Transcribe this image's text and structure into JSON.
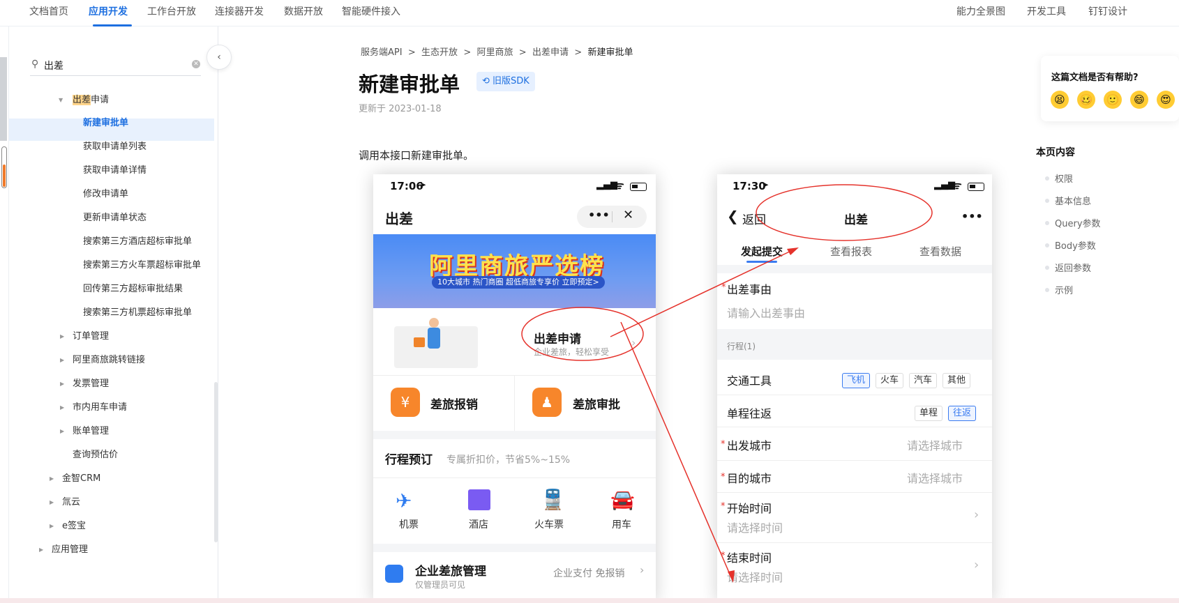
{
  "topnav": {
    "items": [
      "文档首页",
      "应用开发",
      "工作台开放",
      "连接器开发",
      "数据开放",
      "智能硬件接入"
    ],
    "right_items": [
      "能力全景图",
      "开发工具",
      "钉钉设计"
    ]
  },
  "sidebar": {
    "search_value": "出差",
    "tree": [
      {
        "label_hl": "出差",
        "label_rest": "申请"
      },
      {
        "label": "新建审批单"
      },
      {
        "label": "获取申请单列表"
      },
      {
        "label": "获取申请单详情"
      },
      {
        "label": "修改申请单"
      },
      {
        "label": "更新申请单状态"
      },
      {
        "label": "搜索第三方酒店超标审批单"
      },
      {
        "label": "搜索第三方火车票超标审批单"
      },
      {
        "label": "回传第三方超标审批结果"
      },
      {
        "label": "搜索第三方机票超标审批单"
      },
      {
        "label": "订单管理"
      },
      {
        "label": "阿里商旅跳转链接"
      },
      {
        "label": "发票管理"
      },
      {
        "label": "市内用车申请"
      },
      {
        "label": "账单管理"
      },
      {
        "label": "查询预估价"
      },
      {
        "label": "金智CRM"
      },
      {
        "label": "氚云"
      },
      {
        "label": "e签宝"
      },
      {
        "label": "应用管理"
      }
    ]
  },
  "breadcrumb": [
    "服务端API",
    "生态开放",
    "阿里商旅",
    "出差申请",
    "新建审批单"
  ],
  "page": {
    "title": "新建审批单",
    "sdk_badge": "旧版SDK",
    "updated": "更新于 2023-01-18",
    "intro": "调用本接口新建审批单。"
  },
  "phone1": {
    "time": "17:06",
    "title": "出差",
    "banner_title": "阿里商旅严选榜",
    "banner_sub": "10大城市 热门商圈 超低商旅专享价 立即预定>",
    "apply_title": "出差申请",
    "apply_sub": "企业差旅，轻松享受",
    "reimburse": "差旅报销",
    "approval": "差旅审批",
    "booking_title": "行程预订",
    "booking_sub": "专属折扣价，节省5%~15%",
    "services": [
      "机票",
      "酒店",
      "火车票",
      "用车"
    ],
    "mgmt_title": "企业差旅管理",
    "mgmt_sub": "仅管理员可见",
    "mgmt_right": "企业支付 免报销"
  },
  "phone2": {
    "time": "17:30",
    "back": "返回",
    "title": "出差",
    "tabs": [
      "发起提交",
      "查看报表",
      "查看数据"
    ],
    "reason_label": "出差事由",
    "reason_placeholder": "请输入出差事由",
    "trip_section": "行程(1)",
    "transport_label": "交通工具",
    "transport_options": [
      "飞机",
      "火车",
      "汽车",
      "其他"
    ],
    "trip_type_label": "单程往返",
    "trip_type_options": [
      "单程",
      "往返"
    ],
    "depart_label": "出发城市",
    "depart_placeholder": "请选择城市",
    "dest_label": "目的城市",
    "dest_placeholder": "请选择城市",
    "start_label": "开始时间",
    "start_placeholder": "请选择时间",
    "end_label": "结束时间",
    "end_placeholder": "请选择时间"
  },
  "help": {
    "title": "这篇文档是否有帮助?"
  },
  "toc": {
    "title": "本页内容",
    "items": [
      "权限",
      "基本信息",
      "Query参数",
      "Body参数",
      "返回参数",
      "示例"
    ]
  }
}
